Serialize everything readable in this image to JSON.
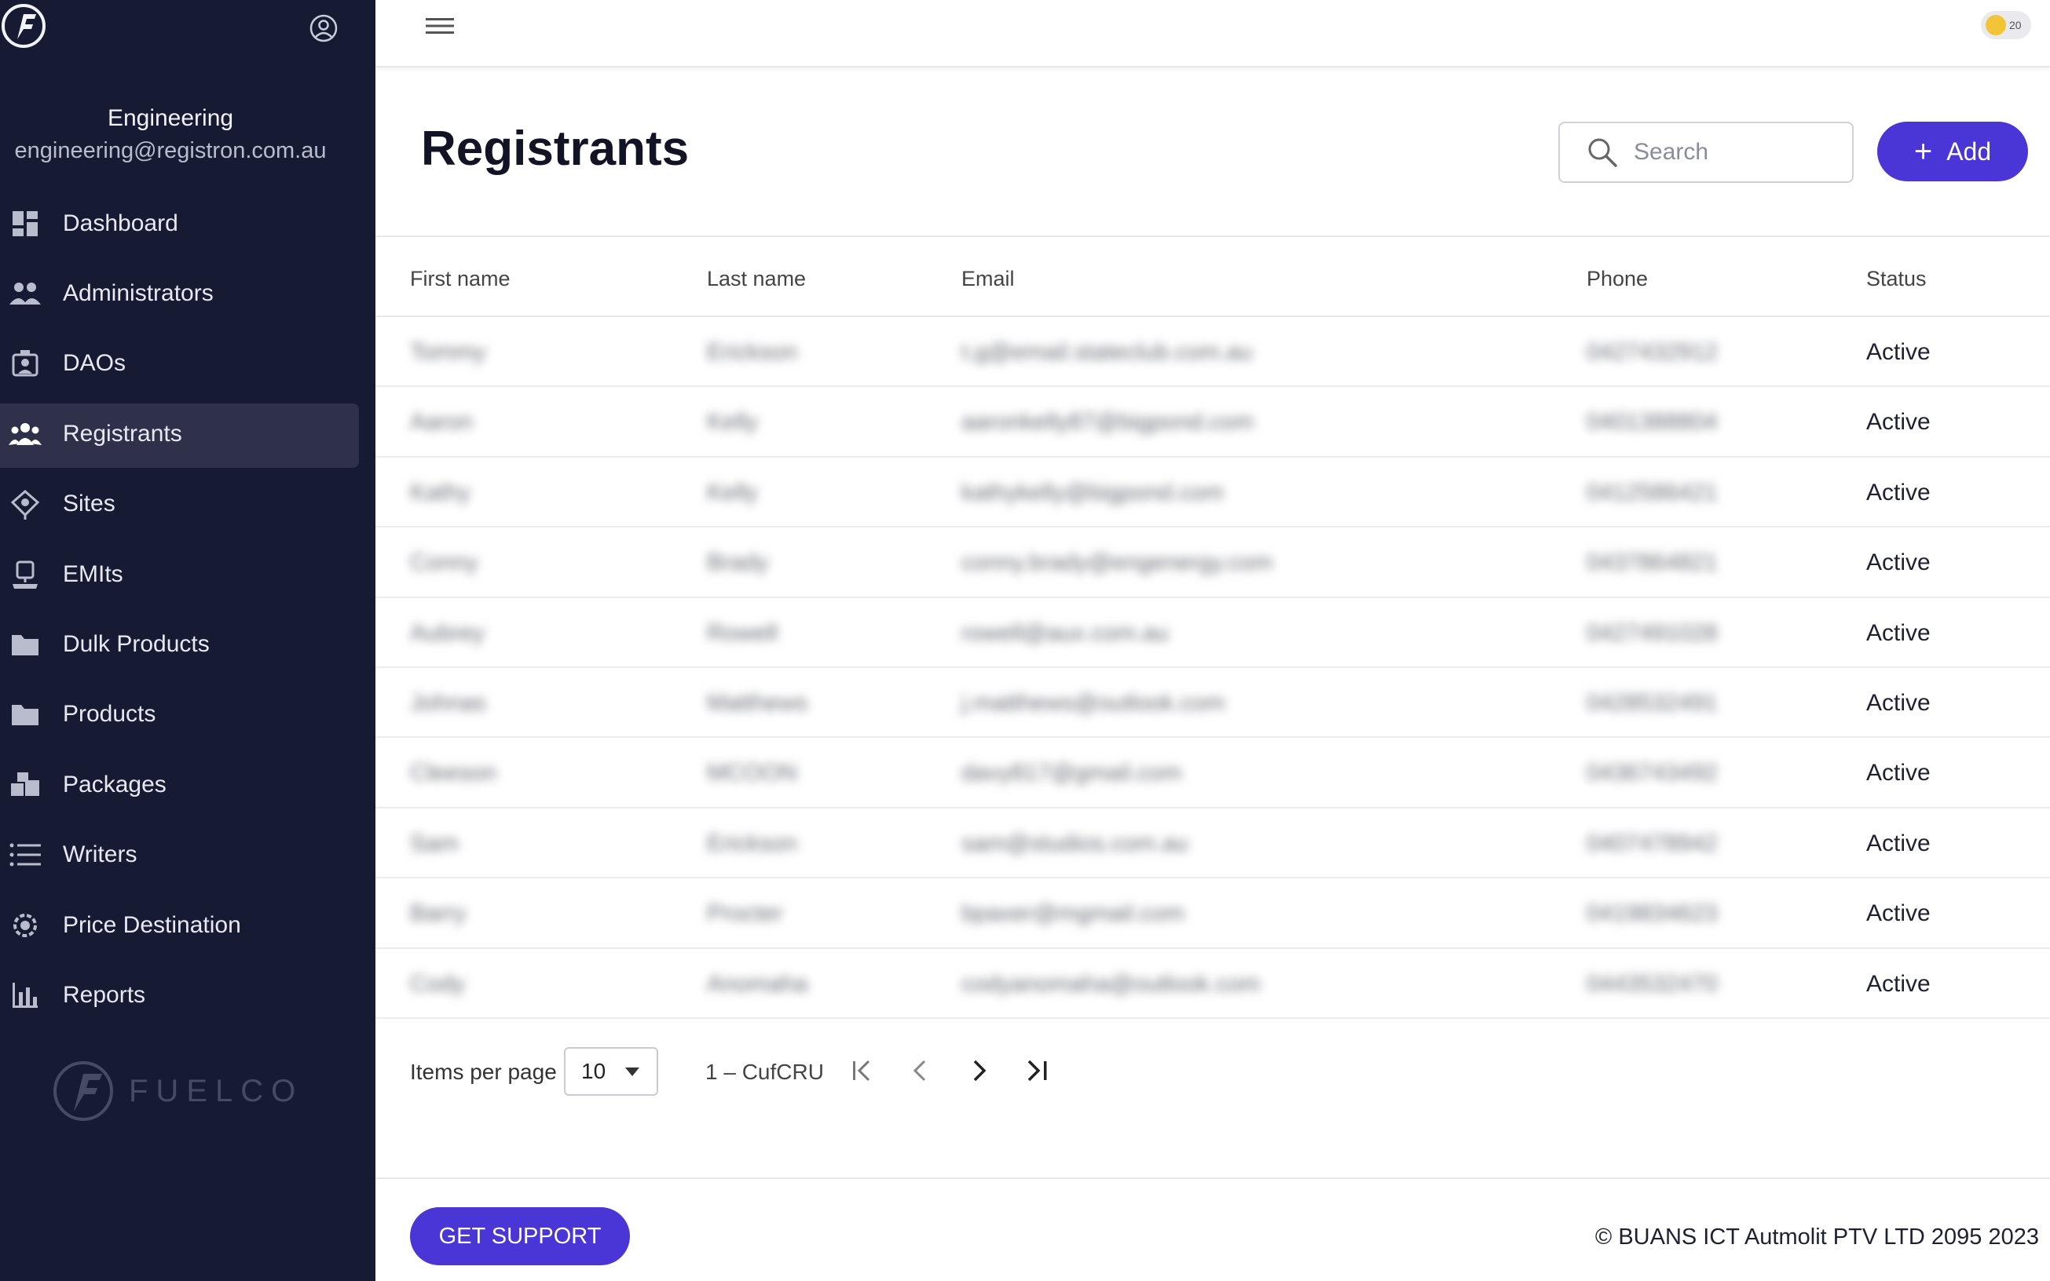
{
  "sidebar": {
    "profile": {
      "name": "Engineering",
      "email": "engineering@registron.com.au"
    },
    "items": [
      {
        "label": "Dashboard",
        "icon": "dashboard-icon"
      },
      {
        "label": "Administrators",
        "icon": "administrators-icon"
      },
      {
        "label": "DAOs",
        "icon": "daos-icon"
      },
      {
        "label": "Registrants",
        "icon": "registrants-icon",
        "active": true
      },
      {
        "label": "Sites",
        "icon": "sites-icon"
      },
      {
        "label": "EMIts",
        "icon": "emits-icon"
      },
      {
        "label": "Dulk Products",
        "icon": "folder-icon"
      },
      {
        "label": "Products",
        "icon": "folder-icon"
      },
      {
        "label": "Packages",
        "icon": "packages-icon"
      },
      {
        "label": "Writers",
        "icon": "list-icon"
      },
      {
        "label": "Price Destination",
        "icon": "gear-icon"
      },
      {
        "label": "Reports",
        "icon": "bar-chart-icon"
      }
    ],
    "brand": "FUELCO"
  },
  "topbar": {
    "badge_count": "20"
  },
  "page": {
    "title": "Registrants",
    "search_placeholder": "Search",
    "add_label": "Add"
  },
  "table": {
    "columns": [
      "First name",
      "Last name",
      "Email",
      "Phone",
      "Status"
    ],
    "rows": [
      {
        "first": "Tommy",
        "last": "Erickson",
        "email": "t.g@email.stateclub.com.au",
        "phone": "0427432912",
        "status": "Active"
      },
      {
        "first": "Aaron",
        "last": "Kelly",
        "email": "aaronkelly87@bigpond.com",
        "phone": "0401388804",
        "status": "Active"
      },
      {
        "first": "Kathy",
        "last": "Kelly",
        "email": "kathykelly@bigpond.com",
        "phone": "0412586421",
        "status": "Active"
      },
      {
        "first": "Conny",
        "last": "Brady",
        "email": "conny.brady@engenergy.com",
        "phone": "0437864821",
        "status": "Active"
      },
      {
        "first": "Aubrey",
        "last": "Rowell",
        "email": "rowell@aux.com.au",
        "phone": "0427491028",
        "status": "Active"
      },
      {
        "first": "Johnas",
        "last": "Matthews",
        "email": "j.matthews@outlook.com",
        "phone": "0428532491",
        "status": "Active"
      },
      {
        "first": "Cleeson",
        "last": "MCOON",
        "email": "davy817@gmail.com",
        "phone": "0436743492",
        "status": "Active"
      },
      {
        "first": "Sam",
        "last": "Erickson",
        "email": "sam@studios.com.au",
        "phone": "0407478942",
        "status": "Active"
      },
      {
        "first": "Barry",
        "last": "Procter",
        "email": "bpaxer@mgmail.com",
        "phone": "0419834623",
        "status": "Active"
      },
      {
        "first": "Cody",
        "last": "Anomaha",
        "email": "codyanomaha@outlook.com",
        "phone": "0443532470",
        "status": "Active"
      }
    ]
  },
  "pagination": {
    "items_per_page_label": "Items per page",
    "items_per_page_value": "10",
    "range_label": "1 – CufCRU"
  },
  "footer": {
    "support_label": "GET SUPPORT",
    "copyright": "© BUANS ICT Autmolit PTV LTD 2095 2023"
  },
  "colors": {
    "sidebar_bg": "#171a33",
    "accent": "#4a35d6",
    "active_item_bg": "#2e3149"
  }
}
